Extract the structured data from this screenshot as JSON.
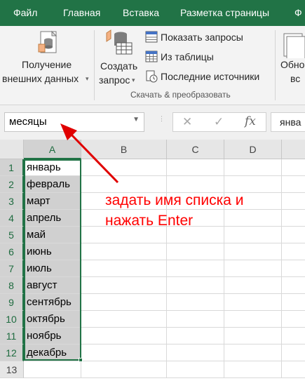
{
  "menu": {
    "tabs": [
      {
        "label": "Файл"
      },
      {
        "label": "Главная"
      },
      {
        "label": "Вставка"
      },
      {
        "label": "Разметка страницы"
      },
      {
        "label": "Ф"
      }
    ]
  },
  "ribbon": {
    "get_external": {
      "line1": "Получение",
      "line2": "внешних данных",
      "icon": "database-import-icon"
    },
    "create_query": {
      "line1": "Создать",
      "line2": "запрос",
      "icon": "query-table-icon"
    },
    "show_queries": {
      "label": "Показать запросы",
      "icon": "show-queries-icon"
    },
    "from_table": {
      "label": "Из таблицы",
      "icon": "table-icon"
    },
    "recent_sources": {
      "label": "Последние источники",
      "icon": "recent-sources-icon"
    },
    "transform_group_label": "Скачать & преобразовать",
    "refresh_all": {
      "line1": "Обно",
      "line2": "вс",
      "icon": "refresh-icon"
    }
  },
  "formula_bar": {
    "name_box_value": "месяцы",
    "cancel_icon": "close-icon",
    "enter_icon": "check-icon",
    "function_label": "fx",
    "formula_value": "янва"
  },
  "sheet": {
    "columns": [
      "A",
      "B",
      "C",
      "D"
    ],
    "selected_column": "A",
    "rows": [
      {
        "num": "1",
        "a": "январь"
      },
      {
        "num": "2",
        "a": "февраль"
      },
      {
        "num": "3",
        "a": "март"
      },
      {
        "num": "4",
        "a": "апрель"
      },
      {
        "num": "5",
        "a": "май"
      },
      {
        "num": "6",
        "a": "июнь"
      },
      {
        "num": "7",
        "a": "июль"
      },
      {
        "num": "8",
        "a": "август"
      },
      {
        "num": "9",
        "a": "сентябрь"
      },
      {
        "num": "10",
        "a": "октябрь"
      },
      {
        "num": "11",
        "a": "ноябрь"
      },
      {
        "num": "12",
        "a": "декабрь"
      },
      {
        "num": "13",
        "a": ""
      }
    ]
  },
  "annotation": {
    "line1": "задать имя списка и",
    "line2": "нажать Enter",
    "color": "#ff0000"
  },
  "colors": {
    "accent": "#217346",
    "selection_fill": "#d0d0d0"
  }
}
